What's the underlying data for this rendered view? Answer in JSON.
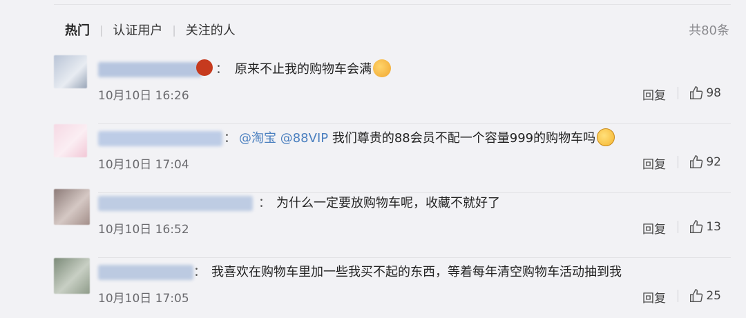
{
  "filters": {
    "hot": "热门",
    "verified": "认证用户",
    "following": "关注的人",
    "sep": "|"
  },
  "total": "共80条",
  "comments": [
    {
      "text": "原来不止我的购物车会满",
      "time": "10月10日 16:26",
      "reply": "回复",
      "likes": "98",
      "emoji": "yum-face-icon"
    },
    {
      "mention1": "@淘宝",
      "mention2": "@88VIP",
      "text": "我们尊贵的88会员不配一个容量999的购物车吗",
      "time": "10月10日 17:04",
      "reply": "回复",
      "likes": "92",
      "emoji": "pleading-face-icon"
    },
    {
      "text": "为什么一定要放购物车呢，收藏不就好了",
      "time": "10月10日 16:52",
      "reply": "回复",
      "likes": "13"
    },
    {
      "text": "我喜欢在购物车里加一些我买不起的东西，等着每年清空购物车活动抽到我",
      "time": "10月10日 17:05",
      "reply": "回复",
      "likes": "25"
    }
  ],
  "colon": "：",
  "colors": {
    "mention": "#4a7fbf",
    "background": "#f2f2f5"
  }
}
